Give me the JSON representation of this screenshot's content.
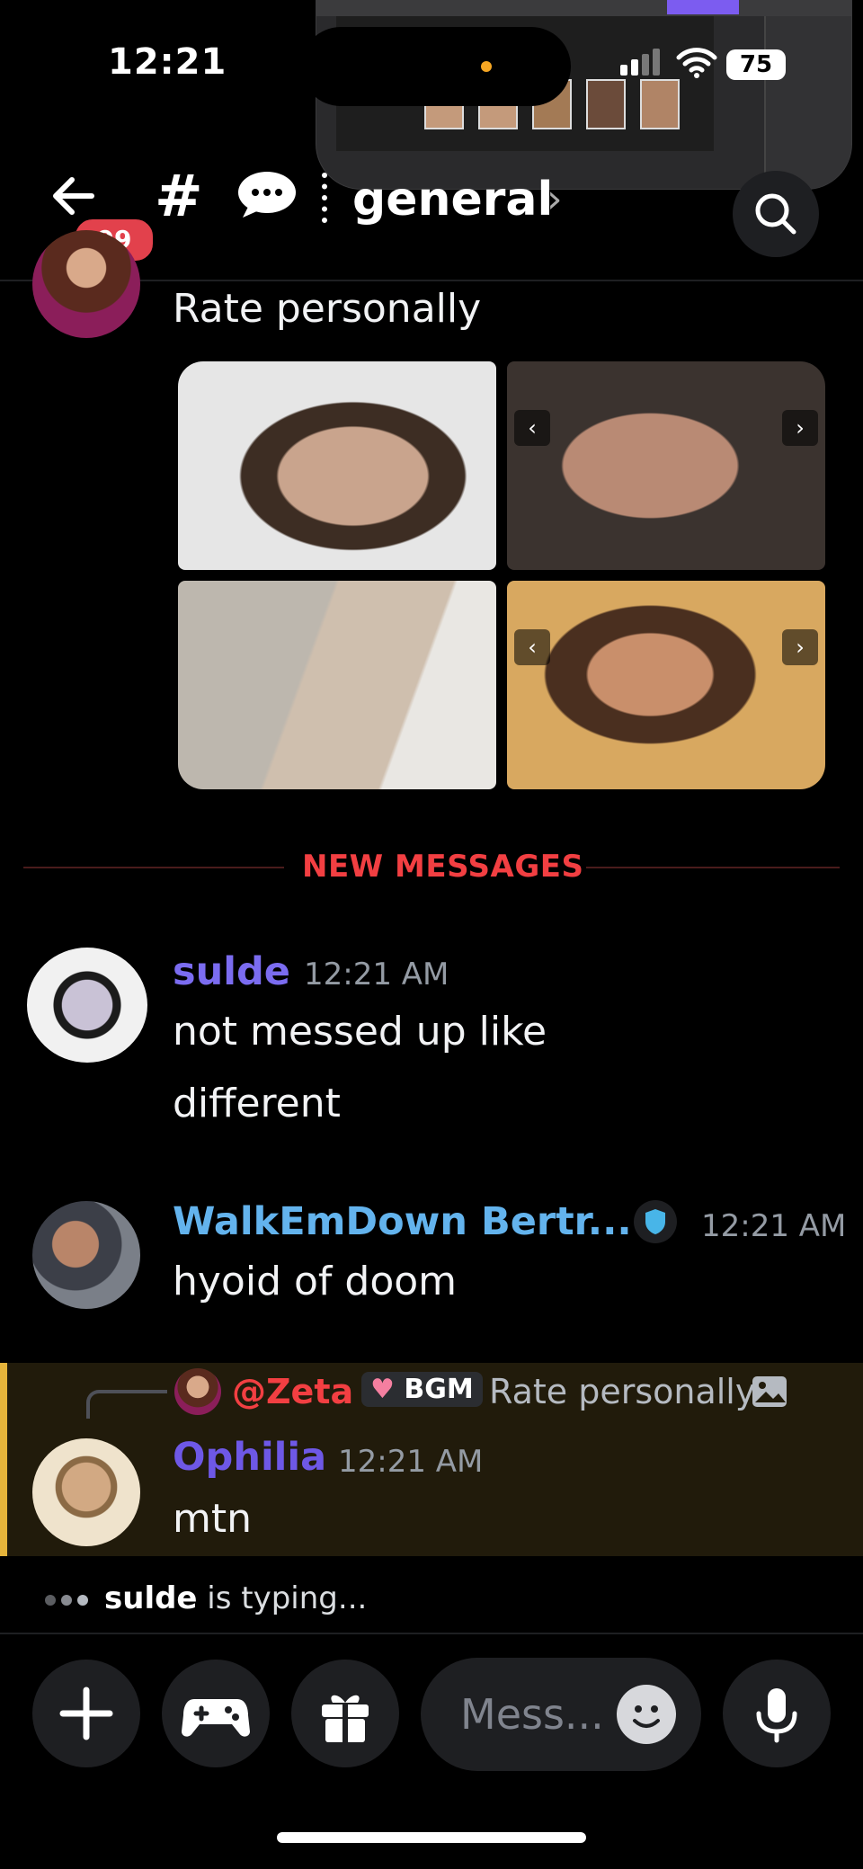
{
  "status_bar": {
    "time": "12:21",
    "battery": "75"
  },
  "header": {
    "badge_count": "99",
    "channel_name": "general",
    "chevron": "›"
  },
  "messages": [
    {
      "text": "Rate personally"
    },
    {
      "author": "sulde",
      "author_color": "#7b6cf0",
      "timestamp": "12:21 AM",
      "lines": [
        "not messed up like",
        "different"
      ]
    },
    {
      "author": "WalkEmDown Bertr...",
      "author_color": "#63b3ed",
      "timestamp": "12:21 AM",
      "lines": [
        "hyoid of doom"
      ]
    },
    {
      "reply": {
        "mention": "@Zeta",
        "tag": "BGM",
        "preview": "Rate personally"
      },
      "author": "Ophilia",
      "author_color": "#6e58e6",
      "timestamp": "12:21 AM",
      "lines": [
        "mtn"
      ]
    }
  ],
  "new_messages_label": "NEW MESSAGES",
  "typing": {
    "user": "sulde",
    "suffix": " is typing..."
  },
  "composer": {
    "placeholder": "Mess..."
  },
  "colors": {
    "background": "#000000",
    "new_messages": "#f23f42",
    "highlight": "#211b0b",
    "highlight_bar": "#e5b43b",
    "badge": "#e2414c"
  },
  "icons": [
    "back-arrow-icon",
    "hash-icon",
    "chat-bubble-icon",
    "search-icon",
    "plus-icon",
    "gamepad-icon",
    "gift-icon",
    "emoji-icon",
    "microphone-icon",
    "image-icon",
    "shield-icon",
    "chevron-left-icon",
    "chevron-right-icon"
  ]
}
